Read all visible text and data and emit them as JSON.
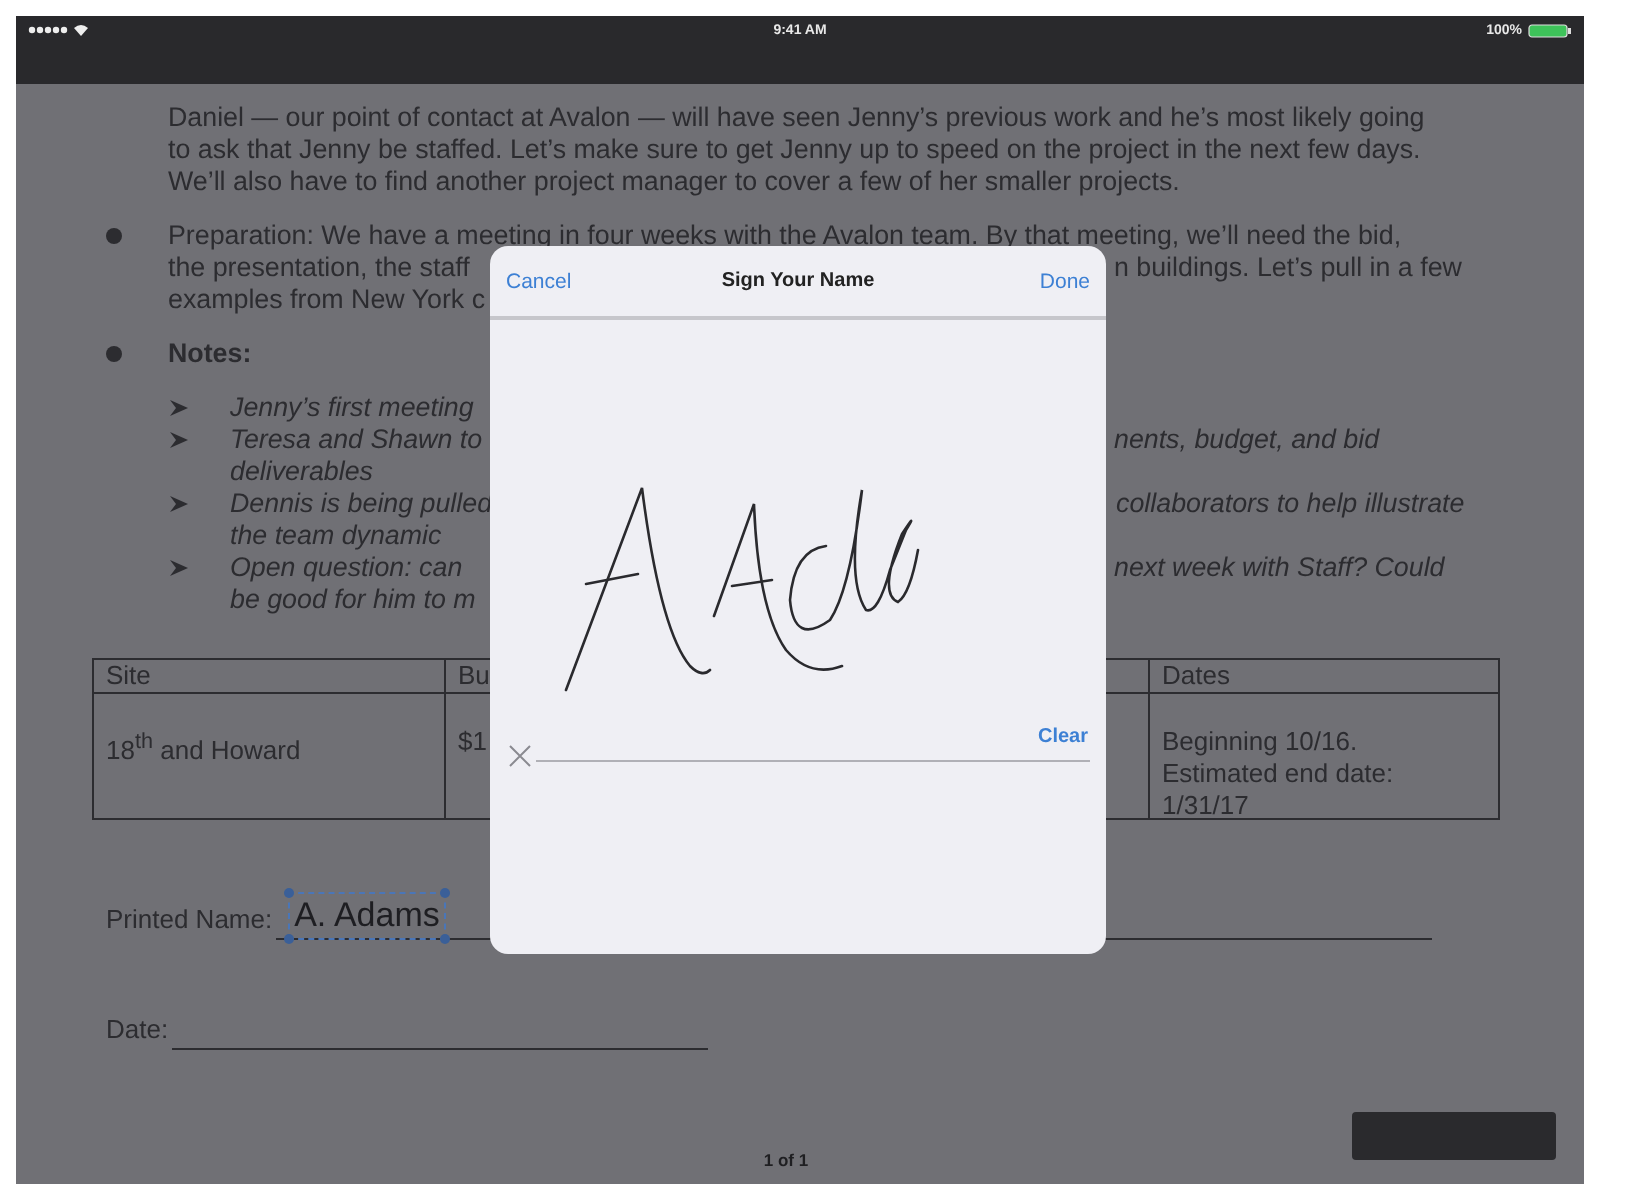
{
  "status_bar": {
    "time": "9:41 AM",
    "battery": "100%"
  },
  "document": {
    "lines": [
      {
        "kind": "text",
        "gap_before": false,
        "left": "Daniel — our point of contact at Avalon — will have seen Jenny’s previous work and he’s most likely going"
      },
      {
        "kind": "text",
        "gap_before": false,
        "left": "to ask that Jenny be staffed. Let’s make sure to get Jenny up to speed on the project in the next few days."
      },
      {
        "kind": "text",
        "gap_before": false,
        "left": "We’ll also have to find another project manager to cover a few of her smaller projects."
      },
      {
        "kind": "bullet",
        "gap_before": true,
        "left": "Preparation: We have a meeting in four weeks with the Avalon team. By that meeting, we’ll need the bid,"
      },
      {
        "kind": "text",
        "gap_before": false,
        "left": "the presentation, the staff",
        "right": "n buildings. Let’s pull in a few"
      },
      {
        "kind": "text",
        "gap_before": false,
        "left": "examples from New York c"
      },
      {
        "kind": "heading",
        "gap_before": true,
        "left": "Notes:"
      },
      {
        "kind": "arrow",
        "gap_before": true,
        "left": "Jenny’s first meeting"
      },
      {
        "kind": "arrow",
        "gap_before": false,
        "left": "Teresa and Shawn to",
        "right": "nents, budget, and bid"
      },
      {
        "kind": "sub",
        "gap_before": false,
        "left": "deliverables"
      },
      {
        "kind": "arrow",
        "gap_before": false,
        "left": "Dennis is being pulled",
        "right": "collaborators to help illustrate"
      },
      {
        "kind": "sub",
        "gap_before": false,
        "left": "the team dynamic"
      },
      {
        "kind": "arrow",
        "gap_before": false,
        "left": "Open question: can",
        "right": "next week with Staff? Could"
      },
      {
        "kind": "sub",
        "gap_before": false,
        "left": "be good for him to m"
      }
    ],
    "table": {
      "columns": [
        {
          "heading": "Site"
        },
        {
          "heading": "Bu"
        },
        {},
        {
          "heading": "Dates"
        }
      ],
      "rows": [
        {
          "cells": [
            [
              "18$^{th}$ and Howard"
            ],
            [
              "$1"
            ],
            null,
            [
              "Beginning 10/16.",
              "Estimated end date:",
              "1/31/17"
            ]
          ]
        }
      ]
    },
    "printed_name": {
      "label": "Printed Name:",
      "value": "A. Adams",
      "selected": true
    },
    "date": {
      "label": "Date:"
    },
    "page_indicator": "1 of 1"
  },
  "dialog": {
    "cancel": "Cancel",
    "title": "Sign Your Name",
    "done": "Done",
    "clear": "Clear"
  }
}
